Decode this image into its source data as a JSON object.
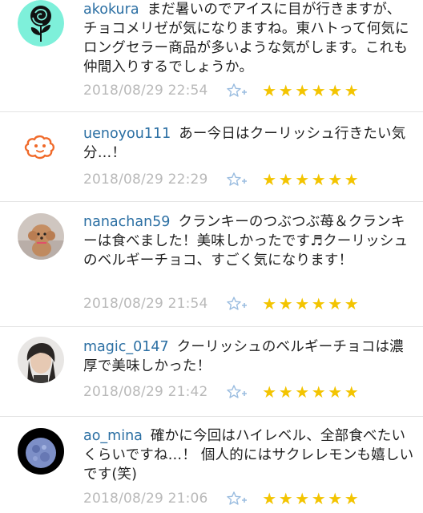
{
  "comments": [
    {
      "username": "akokura",
      "text": "まだ暑いのでアイスに目が行きますが、チョコメリゼが気になりますね。東ハトって何気にロングセラー商品が多いような気がします。これも仲間入りするでしょうか。",
      "timestamp": "2018/08/29 22:54",
      "avatar": "black-rose-icon",
      "rating": 6
    },
    {
      "username": "uenoyou111",
      "text": "あー今日はクーリッシュ行きたい気分…！",
      "timestamp": "2018/08/29 22:29",
      "avatar": "orange-face-icon",
      "rating": 6
    },
    {
      "username": "nanachan59",
      "text": "クランキーのつぶつぶ苺＆クランキーは食べました！美味しかったです♬クーリッシュのベルギーチョコ、すごく気になります！",
      "timestamp": "2018/08/29 21:54",
      "avatar": "poodle-photo",
      "rating": 6
    },
    {
      "username": "magic_0147",
      "text": "クーリッシュのベルギーチョコは濃厚で美味しかった！",
      "timestamp": "2018/08/29 21:42",
      "avatar": "person-photo",
      "rating": 6
    },
    {
      "username": "ao_mina",
      "text": "確かに今回はハイレベル、全部食べたいくらいですね…！ 個人的にはサクレレモンも嬉しいです(笑)",
      "timestamp": "2018/08/29 21:06",
      "avatar": "full-moon-photo",
      "rating": 6
    }
  ],
  "colors": {
    "username": "#2b6fa3",
    "timestamp": "#b9b9b9",
    "star": "#f3c400",
    "favorite_icon": "#9bbde0",
    "divider": "#e3e3e3"
  },
  "icons": {
    "favorite": "star-plus-outline-icon",
    "rating": "star-icon"
  }
}
